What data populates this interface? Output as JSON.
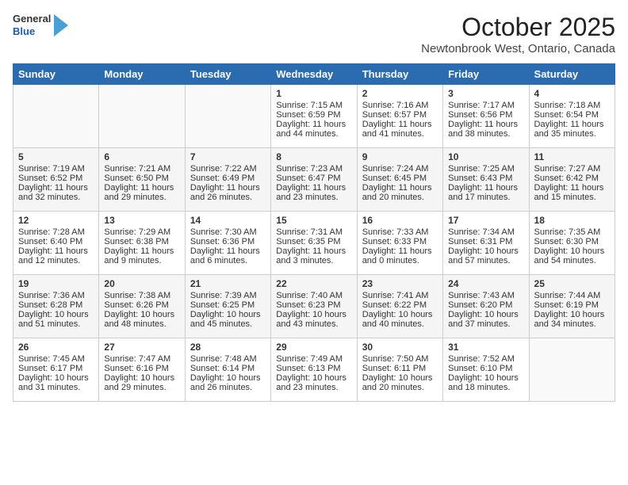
{
  "header": {
    "logo_general": "General",
    "logo_blue": "Blue",
    "month_title": "October 2025",
    "location": "Newtonbrook West, Ontario, Canada"
  },
  "days_of_week": [
    "Sunday",
    "Monday",
    "Tuesday",
    "Wednesday",
    "Thursday",
    "Friday",
    "Saturday"
  ],
  "weeks": [
    [
      {
        "day": "",
        "content": ""
      },
      {
        "day": "",
        "content": ""
      },
      {
        "day": "",
        "content": ""
      },
      {
        "day": "1",
        "content": "Sunrise: 7:15 AM\nSunset: 6:59 PM\nDaylight: 11 hours\nand 44 minutes."
      },
      {
        "day": "2",
        "content": "Sunrise: 7:16 AM\nSunset: 6:57 PM\nDaylight: 11 hours\nand 41 minutes."
      },
      {
        "day": "3",
        "content": "Sunrise: 7:17 AM\nSunset: 6:56 PM\nDaylight: 11 hours\nand 38 minutes."
      },
      {
        "day": "4",
        "content": "Sunrise: 7:18 AM\nSunset: 6:54 PM\nDaylight: 11 hours\nand 35 minutes."
      }
    ],
    [
      {
        "day": "5",
        "content": "Sunrise: 7:19 AM\nSunset: 6:52 PM\nDaylight: 11 hours\nand 32 minutes."
      },
      {
        "day": "6",
        "content": "Sunrise: 7:21 AM\nSunset: 6:50 PM\nDaylight: 11 hours\nand 29 minutes."
      },
      {
        "day": "7",
        "content": "Sunrise: 7:22 AM\nSunset: 6:49 PM\nDaylight: 11 hours\nand 26 minutes."
      },
      {
        "day": "8",
        "content": "Sunrise: 7:23 AM\nSunset: 6:47 PM\nDaylight: 11 hours\nand 23 minutes."
      },
      {
        "day": "9",
        "content": "Sunrise: 7:24 AM\nSunset: 6:45 PM\nDaylight: 11 hours\nand 20 minutes."
      },
      {
        "day": "10",
        "content": "Sunrise: 7:25 AM\nSunset: 6:43 PM\nDaylight: 11 hours\nand 17 minutes."
      },
      {
        "day": "11",
        "content": "Sunrise: 7:27 AM\nSunset: 6:42 PM\nDaylight: 11 hours\nand 15 minutes."
      }
    ],
    [
      {
        "day": "12",
        "content": "Sunrise: 7:28 AM\nSunset: 6:40 PM\nDaylight: 11 hours\nand 12 minutes."
      },
      {
        "day": "13",
        "content": "Sunrise: 7:29 AM\nSunset: 6:38 PM\nDaylight: 11 hours\nand 9 minutes."
      },
      {
        "day": "14",
        "content": "Sunrise: 7:30 AM\nSunset: 6:36 PM\nDaylight: 11 hours\nand 6 minutes."
      },
      {
        "day": "15",
        "content": "Sunrise: 7:31 AM\nSunset: 6:35 PM\nDaylight: 11 hours\nand 3 minutes."
      },
      {
        "day": "16",
        "content": "Sunrise: 7:33 AM\nSunset: 6:33 PM\nDaylight: 11 hours\nand 0 minutes."
      },
      {
        "day": "17",
        "content": "Sunrise: 7:34 AM\nSunset: 6:31 PM\nDaylight: 10 hours\nand 57 minutes."
      },
      {
        "day": "18",
        "content": "Sunrise: 7:35 AM\nSunset: 6:30 PM\nDaylight: 10 hours\nand 54 minutes."
      }
    ],
    [
      {
        "day": "19",
        "content": "Sunrise: 7:36 AM\nSunset: 6:28 PM\nDaylight: 10 hours\nand 51 minutes."
      },
      {
        "day": "20",
        "content": "Sunrise: 7:38 AM\nSunset: 6:26 PM\nDaylight: 10 hours\nand 48 minutes."
      },
      {
        "day": "21",
        "content": "Sunrise: 7:39 AM\nSunset: 6:25 PM\nDaylight: 10 hours\nand 45 minutes."
      },
      {
        "day": "22",
        "content": "Sunrise: 7:40 AM\nSunset: 6:23 PM\nDaylight: 10 hours\nand 43 minutes."
      },
      {
        "day": "23",
        "content": "Sunrise: 7:41 AM\nSunset: 6:22 PM\nDaylight: 10 hours\nand 40 minutes."
      },
      {
        "day": "24",
        "content": "Sunrise: 7:43 AM\nSunset: 6:20 PM\nDaylight: 10 hours\nand 37 minutes."
      },
      {
        "day": "25",
        "content": "Sunrise: 7:44 AM\nSunset: 6:19 PM\nDaylight: 10 hours\nand 34 minutes."
      }
    ],
    [
      {
        "day": "26",
        "content": "Sunrise: 7:45 AM\nSunset: 6:17 PM\nDaylight: 10 hours\nand 31 minutes."
      },
      {
        "day": "27",
        "content": "Sunrise: 7:47 AM\nSunset: 6:16 PM\nDaylight: 10 hours\nand 29 minutes."
      },
      {
        "day": "28",
        "content": "Sunrise: 7:48 AM\nSunset: 6:14 PM\nDaylight: 10 hours\nand 26 minutes."
      },
      {
        "day": "29",
        "content": "Sunrise: 7:49 AM\nSunset: 6:13 PM\nDaylight: 10 hours\nand 23 minutes."
      },
      {
        "day": "30",
        "content": "Sunrise: 7:50 AM\nSunset: 6:11 PM\nDaylight: 10 hours\nand 20 minutes."
      },
      {
        "day": "31",
        "content": "Sunrise: 7:52 AM\nSunset: 6:10 PM\nDaylight: 10 hours\nand 18 minutes."
      },
      {
        "day": "",
        "content": ""
      }
    ]
  ]
}
